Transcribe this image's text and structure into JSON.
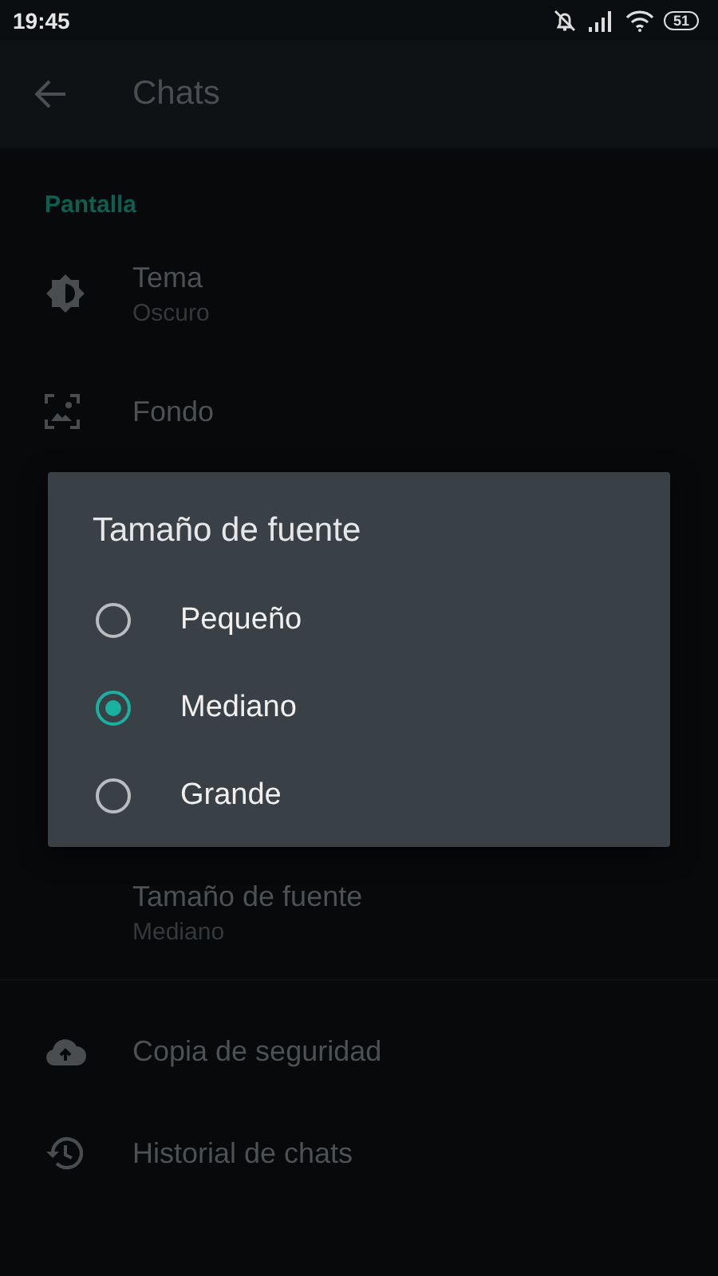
{
  "status_bar": {
    "time": "19:45",
    "battery": "51"
  },
  "app_bar": {
    "title": "Chats"
  },
  "display_section": {
    "header": "Pantalla",
    "items": [
      {
        "title": "Tema",
        "subtitle": "Oscuro"
      },
      {
        "title": "Fondo"
      }
    ]
  },
  "font_size_row": {
    "title": "Tamaño de fuente",
    "subtitle": "Mediano"
  },
  "more_items": [
    {
      "title": "Copia de seguridad"
    },
    {
      "title": "Historial de chats"
    }
  ],
  "dialog": {
    "title": "Tamaño de fuente",
    "options": [
      {
        "label": "Pequeño",
        "selected": false
      },
      {
        "label": "Mediano",
        "selected": true
      },
      {
        "label": "Grande",
        "selected": false
      }
    ]
  }
}
